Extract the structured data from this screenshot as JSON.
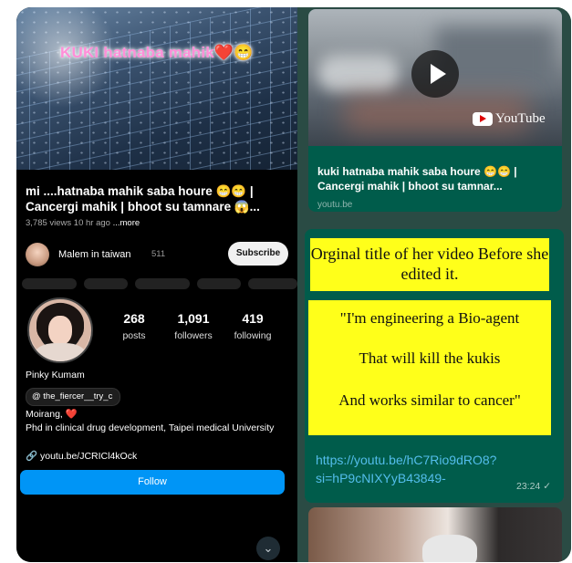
{
  "left_panel": {
    "thumbnail_text": "KUKI hatnaba mahik❤️😁",
    "video_title": "mi ....hatnaba mahik saba houre 😁😁 | Cancergi mahik | bhoot su tamnare 😱...",
    "video_meta": "3,785 views  10 hr ago",
    "more_label": "...more",
    "channel_name": "Malem in taiwan",
    "channel_subs": "511",
    "subscribe_label": "Subscribe",
    "profile": {
      "posts_count": "268",
      "posts_label": "posts",
      "followers_count": "1,091",
      "followers_label": "followers",
      "following_count": "419",
      "following_label": "following",
      "name": "Pinky Kumam",
      "threads_handle": "the_fiercer__try_c",
      "location": "Moirang, ❤️",
      "bio": "Phd in clinical drug development, Taipei medical University",
      "link": "youtu.be/JCRICl4kOck",
      "follow_label": "Follow"
    }
  },
  "right_panel": {
    "youtube_label": "YouTube",
    "link_title": "kuki hatnaba mahik saba houre 😁😁 | Cancergi mahik | bhoot su tamnar...",
    "link_domain": "youtu.be",
    "card1_text": "Orginal title of her video Before she edited it.",
    "card2_line1": "\"I'm engineering a Bio-agent",
    "card2_line2": "That will kill the kukis",
    "card2_line3": "And works similar to cancer\"",
    "message_link": "https://youtu.be/hC7Rio9dRO8?si=hP9cNIXYyB43849-",
    "message_time": "23:24 ✓",
    "scroll_icon": "double-chevron-down-icon"
  }
}
